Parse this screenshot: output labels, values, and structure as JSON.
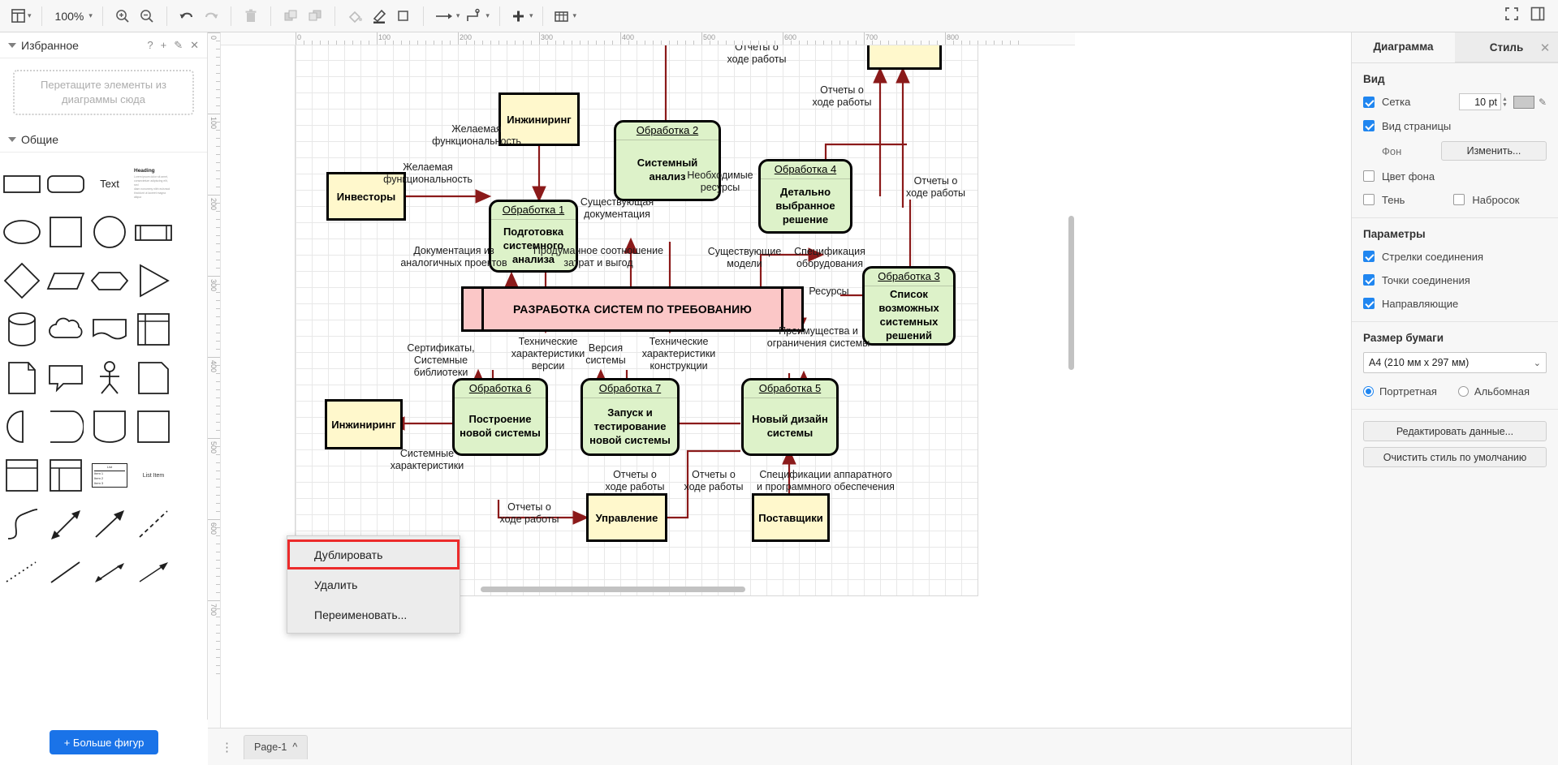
{
  "toolbar": {
    "view_icon": "layout-icon",
    "zoom_level": "100%",
    "items": [
      {
        "name": "view-layout-button",
        "glyph": "▤"
      },
      {
        "name": "zoom-dropdown",
        "glyph": "100%"
      },
      {
        "name": "zoom-in-button",
        "glyph": "zoom-in-icon"
      },
      {
        "name": "zoom-out-button",
        "glyph": "zoom-out-icon"
      },
      {
        "name": "undo-button",
        "glyph": "undo-icon"
      },
      {
        "name": "redo-button",
        "glyph": "redo-icon"
      },
      {
        "name": "delete-button",
        "glyph": "trash-icon"
      },
      {
        "name": "to-front-button",
        "glyph": "bring-front-icon"
      },
      {
        "name": "to-back-button",
        "glyph": "send-back-icon"
      },
      {
        "name": "fill-color-button",
        "glyph": "fill-bucket-icon"
      },
      {
        "name": "line-color-button",
        "glyph": "pen-icon"
      },
      {
        "name": "shadow-button",
        "glyph": "square-icon"
      },
      {
        "name": "connection-arrow-button",
        "glyph": "arrow-icon"
      },
      {
        "name": "waypoints-button",
        "glyph": "waypoint-icon"
      },
      {
        "name": "insert-button",
        "glyph": "plus-icon"
      },
      {
        "name": "table-button",
        "glyph": "table-icon"
      },
      {
        "name": "fullscreen-button",
        "glyph": "expand-icon"
      },
      {
        "name": "format-panel-button",
        "glyph": "panel-icon"
      }
    ]
  },
  "left_panel": {
    "favorites": {
      "title": "Избранное",
      "help_icon": "?",
      "add_icon": "+",
      "edit_icon": "✎",
      "close_icon": "✕",
      "dropzone_line1": "Перетащите элементы из",
      "dropzone_line2": "диаграммы сюда"
    },
    "general": {
      "title": "Общие",
      "shapes": [
        "rectangle",
        "rounded-rectangle",
        "text",
        "heading-textblock",
        "ellipse",
        "square",
        "circle",
        "process",
        "diamond",
        "parallelogram",
        "hexagon",
        "triangle",
        "cylinder",
        "cloud",
        "document",
        "internal-storage",
        "page",
        "callout",
        "actor",
        "note",
        "half-circle",
        "partial-rectangle",
        "container",
        "square2",
        "list-box",
        "list-table",
        "list-item-label",
        "list-item",
        "curve",
        "bidirectional-arrow",
        "arrow-up-right",
        "dashed-line",
        "dotted-line",
        "line",
        "double-arrow",
        "thin-arrow"
      ],
      "text_shape_label": "Text",
      "heading_shape_label": "Heading",
      "list_item_label": "List Item",
      "list_label": "List"
    },
    "more_shapes_button": "+ Больше фигур"
  },
  "rulers": {
    "horizontal_ticks": [
      "0",
      "100",
      "200",
      "300",
      "400",
      "500",
      "600",
      "700",
      "800"
    ],
    "vertical_ticks": [
      "0",
      "100",
      "200",
      "300",
      "400",
      "500",
      "600",
      "700"
    ]
  },
  "right_panel": {
    "tabs": [
      {
        "label": "Диаграмма",
        "active": true
      },
      {
        "label": "Стиль",
        "active": false
      }
    ],
    "close_icon": "✕",
    "view_section": {
      "title": "Вид",
      "grid": {
        "label": "Сетка",
        "checked": true,
        "size": "10 pt",
        "color": "#c9c9c9"
      },
      "page_view": {
        "label": "Вид страницы",
        "checked": true
      },
      "background": {
        "label": "Фон",
        "button": "Изменить..."
      },
      "background_color": {
        "label": "Цвет фона",
        "checked": false
      },
      "shadow": {
        "label": "Тень",
        "checked": false
      },
      "sketch": {
        "label": "Набросок",
        "checked": false
      }
    },
    "params_section": {
      "title": "Параметры",
      "items": [
        {
          "label": "Стрелки соединения",
          "checked": true
        },
        {
          "label": "Точки соединения",
          "checked": true
        },
        {
          "label": "Направляющие",
          "checked": true
        }
      ]
    },
    "paper_section": {
      "title": "Размер бумаги",
      "selected": "A4 (210 мм x 297 мм)",
      "orientation": [
        {
          "label": "Портретная",
          "selected": true
        },
        {
          "label": "Альбомная",
          "selected": false
        }
      ]
    },
    "actions": [
      "Редактировать данные...",
      "Очистить стиль по умолчанию"
    ]
  },
  "context_menu": {
    "items": [
      {
        "label": "Дублировать",
        "highlighted": true
      },
      {
        "label": "Удалить",
        "highlighted": false
      },
      {
        "label": "Переименовать...",
        "highlighted": false
      }
    ]
  },
  "bottom_bar": {
    "menu_icon": "⋮",
    "page_tab": "Page-1",
    "page_caret": "^"
  },
  "diagram": {
    "externals": [
      {
        "id": "inzh-top",
        "label": "Инжиниринг"
      },
      {
        "id": "investory",
        "label": "Инвесторы"
      },
      {
        "id": "inzh-bottom",
        "label": "Инжиниринг"
      },
      {
        "id": "upravlenie",
        "label": "Управление"
      },
      {
        "id": "postavshiki",
        "label": "Поставщики"
      },
      {
        "id": "top-right-partial",
        "label": ""
      }
    ],
    "processes": [
      {
        "id": "p1",
        "header": "Обработка 1",
        "body": "Подготовка\nсистемного\nанализа"
      },
      {
        "id": "p2",
        "header": "Обработка 2",
        "body": "Системный\nанализ"
      },
      {
        "id": "p3",
        "header": "Обработка 3",
        "body": "Список\nвозможных\nсистемных\nрешений"
      },
      {
        "id": "p4",
        "header": "Обработка 4",
        "body": "Детально\nвыбранное\nрешение"
      },
      {
        "id": "p5",
        "header": "Обработка 5",
        "body": "Новый\nдизайн\nсистемы"
      },
      {
        "id": "p6",
        "header": "Обработка 6",
        "body": "Построение\nновой\nсистемы"
      },
      {
        "id": "p7",
        "header": "Обработка 7",
        "body": "Запуск\nи тестирование\nновой системы"
      }
    ],
    "central": {
      "label": "РАЗРАБОТКА СИСТЕМ ПО ТРЕБОВАНИЮ"
    },
    "edge_labels": [
      {
        "id": "e1",
        "text": "Отчеты о\nходе работы"
      },
      {
        "id": "e2",
        "text": "Отчеты о\nходе работы"
      },
      {
        "id": "e3",
        "text": "Желаемая\nфункциональность"
      },
      {
        "id": "e4",
        "text": "Желаемая\nфункциональность"
      },
      {
        "id": "e5",
        "text": "Необходимые\nресурсы"
      },
      {
        "id": "e6",
        "text": "Существующая\nдокументация"
      },
      {
        "id": "e7",
        "text": "Отчеты о\nходе работы"
      },
      {
        "id": "e8",
        "text": "Документация из\nаналогичных проектов"
      },
      {
        "id": "e9",
        "text": "Продуманное соотношение\nзатрат и выгод"
      },
      {
        "id": "e10",
        "text": "Существующие\nмодели"
      },
      {
        "id": "e11",
        "text": "Спецификация\nоборудования"
      },
      {
        "id": "e12",
        "text": "Ресурсы"
      },
      {
        "id": "e13",
        "text": "Преимущества и\nограничения системы"
      },
      {
        "id": "e14",
        "text": "Сертификаты,\nСистемные\nбиблиотеки"
      },
      {
        "id": "e15",
        "text": "Технические\nхарактеристики\nверсии"
      },
      {
        "id": "e16",
        "text": "Версия\nсистемы"
      },
      {
        "id": "e17",
        "text": "Технические\nхарактеристики\nконструкции"
      },
      {
        "id": "e18",
        "text": "Системные\nхарактеристики"
      },
      {
        "id": "e19",
        "text": "Отчеты о\nходе работы"
      },
      {
        "id": "e20",
        "text": "Отчеты о\nходе работы"
      },
      {
        "id": "e21",
        "text": "Отчеты о\nходе работы"
      },
      {
        "id": "e22",
        "text": "Спецификации аппаратного\nи программного обеспечения"
      }
    ],
    "colors": {
      "external_fill": "#fff8cc",
      "process_fill": "#ddf2c9",
      "central_fill": "#fbc7c7",
      "edge": "#8b1a1a",
      "border": "#000000"
    }
  }
}
